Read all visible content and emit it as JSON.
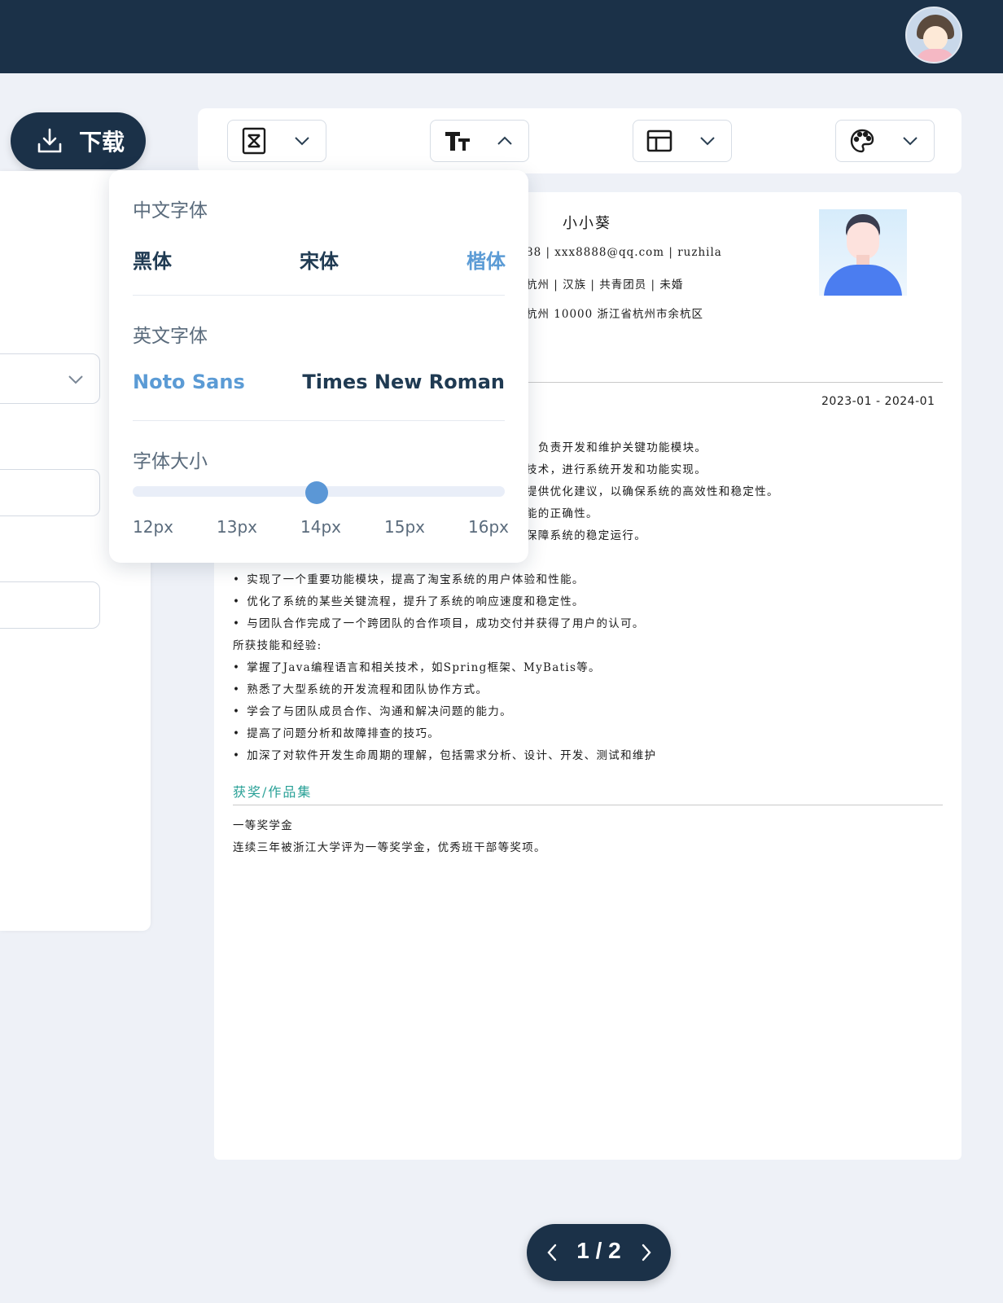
{
  "header": {
    "avatar": "user-avatar"
  },
  "download": {
    "label": "下载"
  },
  "toolbar": {
    "items": [
      {
        "icon": "template-icon",
        "state": "collapsed"
      },
      {
        "icon": "font-icon",
        "state": "expanded"
      },
      {
        "icon": "layout-icon",
        "state": "collapsed"
      },
      {
        "icon": "palette-icon",
        "state": "collapsed"
      }
    ]
  },
  "font_panel": {
    "chinese_heading": "中文字体",
    "chinese_fonts": [
      "黑体",
      "宋体",
      "楷体"
    ],
    "chinese_selected": "楷体",
    "english_heading": "英文字体",
    "english_fonts": [
      "Noto Sans",
      "Times New Roman"
    ],
    "english_selected": "Noto Sans",
    "size_heading": "字体大小",
    "sizes": [
      "12px",
      "13px",
      "14px",
      "15px",
      "16px"
    ],
    "size_selected": "14px",
    "accent": "#5b9bd5"
  },
  "resume": {
    "name": "小小葵",
    "contact": "88 | xxx8888@qq.com | ruzhila",
    "info": "杭州 | 汉族 | 共青团员 | 未婚",
    "address": "杭州 10000 浙江省杭州市余杭区",
    "date_range": "2023-01 - 2024-01",
    "duties": [
      "负责开发和维护关键功能模块。",
      "技术，进行系统开发和功能实现。",
      "提供优化建议，以确保系统的高效性和稳定性。",
      "能的正确性。",
      "保障系统的稳定运行。"
    ],
    "achievements": [
      "实现了一个重要功能模块，提高了淘宝系统的用户体验和性能。",
      "优化了系统的某些关键流程，提升了系统的响应速度和稳定性。",
      "与团队合作完成了一个跨团队的合作项目，成功交付并获得了用户的认可。"
    ],
    "skills_heading": "所获技能和经验:",
    "skills": [
      "掌握了Java编程语言和相关技术，如Spring框架、MyBatis等。",
      "熟悉了大型系统的开发流程和团队协作方式。",
      "学会了与团队成员合作、沟通和解决问题的能力。",
      "提高了问题分析和故障排查的技巧。",
      "加深了对软件开发生命周期的理解，包括需求分析、设计、开发、测试和维护"
    ],
    "awards_title": "获奖/作品集",
    "award_name": "一等奖学金",
    "award_desc": "连续三年被浙江大学评为一等奖学金，优秀班干部等奖项。",
    "accent": "#27a096"
  },
  "pager": {
    "text": "1 / 2",
    "current": 1,
    "total": 2
  }
}
